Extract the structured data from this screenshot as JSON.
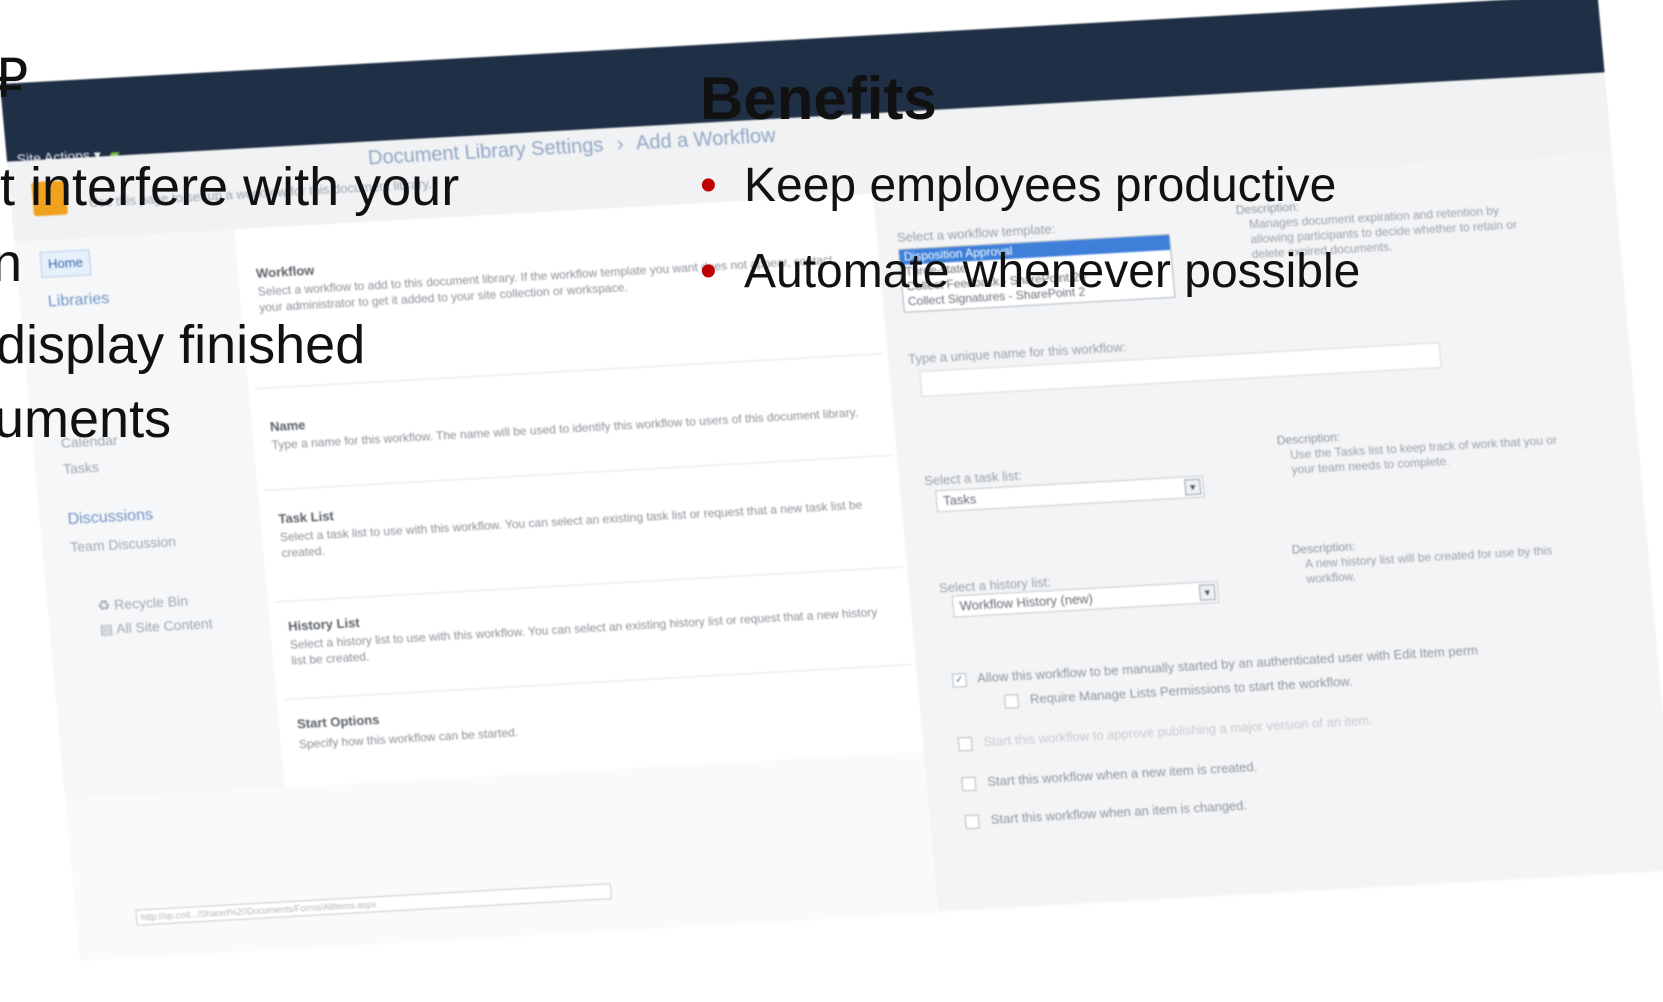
{
  "screenshot": {
    "site_actions": "Site Actions ▾",
    "breadcrumb": {
      "first": "Document Library Settings",
      "separator": "›",
      "current": "Add a Workflow"
    },
    "page_description": "Use this page to set up a workflow for this document library.",
    "nav": {
      "home": "Home",
      "libraries": "Libraries",
      "calendar": "Calendar",
      "tasks": "Tasks",
      "discussions": "Discussions",
      "team_discussion": "Team Discussion",
      "recycle_bin": "Recycle Bin",
      "all_site_content": "All Site Content"
    },
    "sections": {
      "workflow": {
        "title": "Workflow",
        "desc": "Select a workflow to add to this document library. If the workflow template you want does not appear, contact your administrator to get it added to your site collection or workspace."
      },
      "name": {
        "title": "Name",
        "desc": "Type a name for this workflow. The name will be used to identify this workflow to users of this document library."
      },
      "task_list": {
        "title": "Task List",
        "desc": "Select a task list to use with this workflow. You can select an existing task list or request that a new task list be created."
      },
      "history_list": {
        "title": "History List",
        "desc": "Select a history list to use with this workflow. You can select an existing history list or request that a new history list be created."
      },
      "start_options": {
        "title": "Start Options",
        "desc": "Specify how this workflow can be started."
      }
    },
    "form": {
      "template_label": "Select a workflow template:",
      "templates": [
        "Disposition Approval",
        "Three-state",
        "Collect Feedback - SharePoint 20",
        "Collect Signatures - SharePoint 2"
      ],
      "template_selected_index": 0,
      "template_desc_head": "Description:",
      "template_desc": "Manages document expiration and retention by allowing participants to decide whether to retain or delete expired documents.",
      "name_label": "Type a unique name for this workflow:",
      "name_value": "",
      "task_label": "Select a task list:",
      "task_value": "Tasks",
      "task_desc_head": "Description:",
      "task_desc": "Use the Tasks list to keep track of work that you or your team needs to complete.",
      "history_label": "Select a history list:",
      "history_value": "Workflow History (new)",
      "history_desc_head": "Description:",
      "history_desc": "A new history list will be created for use by this workflow.",
      "opt_manual": "Allow this workflow to be manually started by an authenticated user with Edit Item perm",
      "opt_manual_checked": true,
      "opt_require": "Require Manage Lists Permissions to start the workflow.",
      "opt_require_checked": false,
      "opt_approve": "Start this workflow to approve publishing a major version of an item.",
      "opt_new": "Start this workflow when a new item is created.",
      "opt_changed": "Start this workflow when an item is changed."
    },
    "status_url": "http://sp.cod.../Shared%20Documents/Forms/AllItems.aspx"
  },
  "slide": {
    "left_lines": [
      "t interfere with your",
      "n",
      " display finished",
      "uments"
    ],
    "benefits_title": "Benefits",
    "bullet_char": "•",
    "bullets": [
      "Keep employees productive",
      "Automate whenever possible"
    ],
    "accent_color": "#c00000"
  }
}
